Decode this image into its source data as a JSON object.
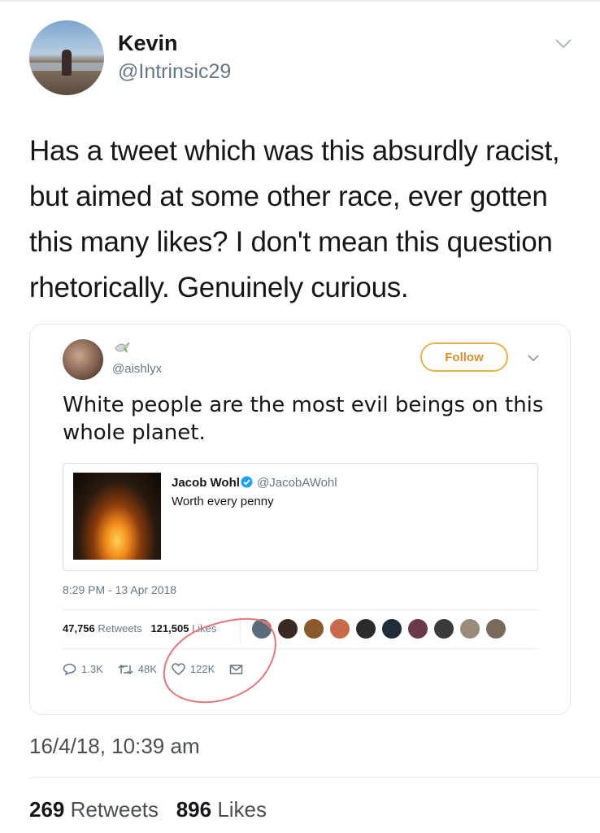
{
  "tweet": {
    "display_name": "Kevin",
    "handle": "@Intrinsic29",
    "text": "Has a tweet which was this absurdly racist, but aimed at some other race, ever gotten this many likes? I don't mean this question rhetorically. Genuinely curious.",
    "date": "16/4/18, 10:39 am",
    "retweets_count": "269",
    "retweets_label": "Retweets",
    "likes_count": "896",
    "likes_label": "Likes"
  },
  "embedded_tweet": {
    "handle": "@aishlyx",
    "follow_label": "Follow",
    "text": "White people are the most evil beings on this whole planet.",
    "timestamp": "8:29 PM - 13 Apr 2018",
    "retweets_count": "47,756",
    "retweets_label": "Retweets",
    "likes_count": "121,505",
    "likes_label": "Likes",
    "reply_count": "1.3K",
    "retweet_action_count": "48K",
    "like_action_count": "122K",
    "quoted": {
      "name": "Jacob Wohl",
      "handle": "@JacobAWohl",
      "text": "Worth every penny"
    }
  },
  "colors": {
    "follow_accent": "#e8b24a",
    "annotation_circle": "#e8757a",
    "verified_blue": "#1da1f2"
  },
  "icons": [
    "chevron-down-icon",
    "dove-icon",
    "verified-icon",
    "reply-icon",
    "retweet-icon",
    "like-icon",
    "message-icon"
  ]
}
